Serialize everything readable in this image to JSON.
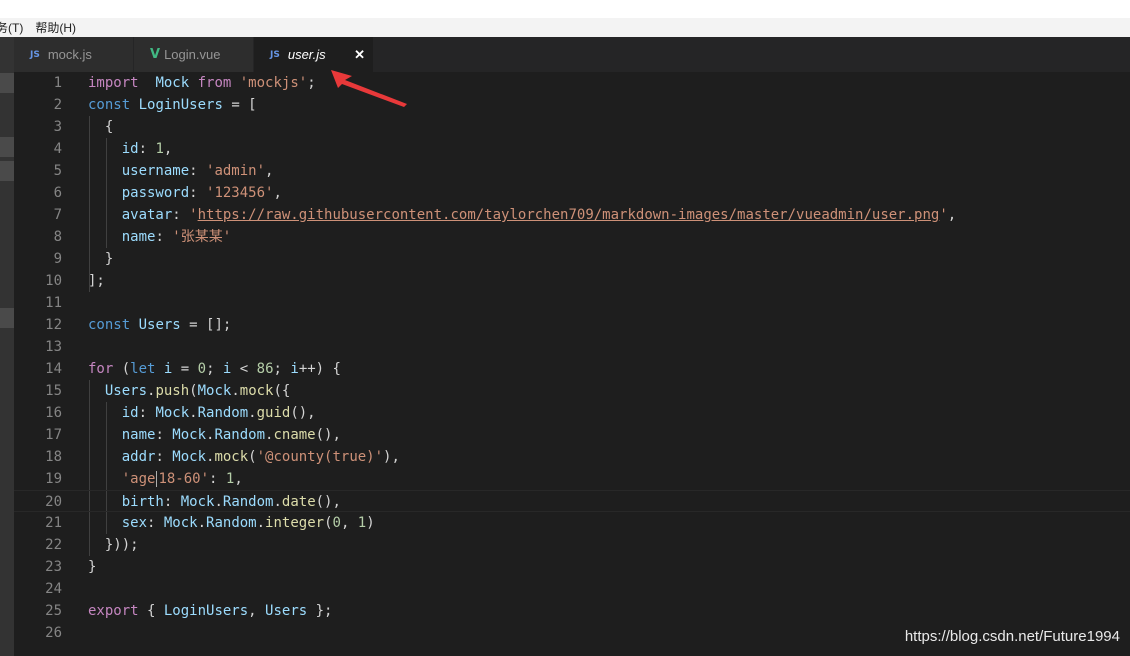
{
  "menu": {
    "items": [
      "务(T)",
      "帮助(H)"
    ]
  },
  "tabs": [
    {
      "icon": "JS",
      "label": "mock.js",
      "active": false
    },
    {
      "icon": "V",
      "label": "Login.vue",
      "active": false
    },
    {
      "icon": "JS",
      "label": "user.js",
      "active": true,
      "close": "✕"
    }
  ],
  "code": {
    "lines": [
      {
        "n": "1",
        "tokens": [
          [
            "ctl",
            "import"
          ],
          [
            "",
            "  "
          ],
          [
            "var",
            "Mock"
          ],
          [
            "",
            " "
          ],
          [
            "ctl",
            "from"
          ],
          [
            "",
            " "
          ],
          [
            "str",
            "'mockjs'"
          ],
          [
            "",
            ";"
          ]
        ]
      },
      {
        "n": "2",
        "tokens": [
          [
            "kw",
            "const"
          ],
          [
            "",
            " "
          ],
          [
            "var",
            "LoginUsers"
          ],
          [
            "",
            " = ["
          ]
        ]
      },
      {
        "n": "3",
        "tokens": [
          [
            "",
            "  {"
          ]
        ]
      },
      {
        "n": "4",
        "tokens": [
          [
            "",
            "    "
          ],
          [
            "var",
            "id"
          ],
          [
            "",
            ": "
          ],
          [
            "num",
            "1"
          ],
          [
            "",
            ","
          ]
        ]
      },
      {
        "n": "5",
        "tokens": [
          [
            "",
            "    "
          ],
          [
            "var",
            "username"
          ],
          [
            "",
            ": "
          ],
          [
            "str",
            "'admin'"
          ],
          [
            "",
            ","
          ]
        ]
      },
      {
        "n": "6",
        "tokens": [
          [
            "",
            "    "
          ],
          [
            "var",
            "password"
          ],
          [
            "",
            ": "
          ],
          [
            "str",
            "'123456'"
          ],
          [
            "",
            ","
          ]
        ]
      },
      {
        "n": "7",
        "tokens": [
          [
            "",
            "    "
          ],
          [
            "var",
            "avatar"
          ],
          [
            "",
            ": "
          ],
          [
            "str",
            "'"
          ],
          [
            "url",
            "https://raw.githubusercontent.com/taylorchen709/markdown-images/master/vueadmin/user.png"
          ],
          [
            "str",
            "'"
          ],
          [
            "",
            ","
          ]
        ]
      },
      {
        "n": "8",
        "tokens": [
          [
            "",
            "    "
          ],
          [
            "var",
            "name"
          ],
          [
            "",
            ": "
          ],
          [
            "str",
            "'张某某'"
          ]
        ]
      },
      {
        "n": "9",
        "tokens": [
          [
            "",
            "  }"
          ]
        ]
      },
      {
        "n": "10",
        "tokens": [
          [
            "",
            "];"
          ]
        ]
      },
      {
        "n": "11",
        "tokens": []
      },
      {
        "n": "12",
        "tokens": [
          [
            "kw",
            "const"
          ],
          [
            "",
            " "
          ],
          [
            "var",
            "Users"
          ],
          [
            "",
            " = [];"
          ]
        ]
      },
      {
        "n": "13",
        "tokens": []
      },
      {
        "n": "14",
        "tokens": [
          [
            "ctl",
            "for"
          ],
          [
            "",
            " ("
          ],
          [
            "kw",
            "let"
          ],
          [
            "",
            " "
          ],
          [
            "var",
            "i"
          ],
          [
            "",
            " = "
          ],
          [
            "num",
            "0"
          ],
          [
            "",
            "; "
          ],
          [
            "var",
            "i"
          ],
          [
            "",
            " < "
          ],
          [
            "num",
            "86"
          ],
          [
            "",
            "; "
          ],
          [
            "var",
            "i"
          ],
          [
            "",
            "++) {"
          ]
        ]
      },
      {
        "n": "15",
        "tokens": [
          [
            "",
            "  "
          ],
          [
            "var",
            "Users"
          ],
          [
            "",
            "."
          ],
          [
            "fn",
            "push"
          ],
          [
            "",
            "("
          ],
          [
            "var",
            "Mock"
          ],
          [
            "",
            "."
          ],
          [
            "fn",
            "mock"
          ],
          [
            "",
            "({"
          ]
        ]
      },
      {
        "n": "16",
        "tokens": [
          [
            "",
            "    "
          ],
          [
            "var",
            "id"
          ],
          [
            "",
            ": "
          ],
          [
            "var",
            "Mock"
          ],
          [
            "",
            "."
          ],
          [
            "var",
            "Random"
          ],
          [
            "",
            "."
          ],
          [
            "fn",
            "guid"
          ],
          [
            "",
            "(),"
          ]
        ]
      },
      {
        "n": "17",
        "tokens": [
          [
            "",
            "    "
          ],
          [
            "var",
            "name"
          ],
          [
            "",
            ": "
          ],
          [
            "var",
            "Mock"
          ],
          [
            "",
            "."
          ],
          [
            "var",
            "Random"
          ],
          [
            "",
            "."
          ],
          [
            "fn",
            "cname"
          ],
          [
            "",
            "(),"
          ]
        ]
      },
      {
        "n": "18",
        "tokens": [
          [
            "",
            "    "
          ],
          [
            "var",
            "addr"
          ],
          [
            "",
            ": "
          ],
          [
            "var",
            "Mock"
          ],
          [
            "",
            "."
          ],
          [
            "fn",
            "mock"
          ],
          [
            "",
            "("
          ],
          [
            "str",
            "'@county(true)'"
          ],
          [
            "",
            "),"
          ]
        ]
      },
      {
        "n": "19",
        "tokens": [
          [
            "",
            "    "
          ],
          [
            "str",
            "'age"
          ],
          [
            "caret",
            ""
          ],
          [
            "str",
            "18-60'"
          ],
          [
            "",
            ": "
          ],
          [
            "num",
            "1"
          ],
          [
            "",
            ","
          ]
        ]
      },
      {
        "n": "20",
        "tokens": [
          [
            "",
            "    "
          ],
          [
            "var",
            "birth"
          ],
          [
            "",
            ": "
          ],
          [
            "var",
            "Mock"
          ],
          [
            "",
            "."
          ],
          [
            "var",
            "Random"
          ],
          [
            "",
            "."
          ],
          [
            "fn",
            "date"
          ],
          [
            "",
            "(),"
          ]
        ]
      },
      {
        "n": "21",
        "tokens": [
          [
            "",
            "    "
          ],
          [
            "var",
            "sex"
          ],
          [
            "",
            ": "
          ],
          [
            "var",
            "Mock"
          ],
          [
            "",
            "."
          ],
          [
            "var",
            "Random"
          ],
          [
            "",
            "."
          ],
          [
            "fn",
            "integer"
          ],
          [
            "",
            "("
          ],
          [
            "num",
            "0"
          ],
          [
            "",
            ", "
          ],
          [
            "num",
            "1"
          ],
          [
            "",
            ")"
          ]
        ]
      },
      {
        "n": "22",
        "tokens": [
          [
            "",
            "  }));"
          ]
        ]
      },
      {
        "n": "23",
        "tokens": [
          [
            "",
            "}"
          ]
        ]
      },
      {
        "n": "24",
        "tokens": []
      },
      {
        "n": "25",
        "tokens": [
          [
            "ctl",
            "export"
          ],
          [
            "",
            " { "
          ],
          [
            "var",
            "LoginUsers"
          ],
          [
            "",
            ", "
          ],
          [
            "var",
            "Users"
          ],
          [
            "",
            " };"
          ]
        ]
      },
      {
        "n": "26",
        "tokens": []
      }
    ],
    "current_line": "20"
  },
  "watermark": "https://blog.csdn.net/Future1994",
  "colors": {
    "arrow": "#e8393a",
    "keyword": "#569cd6",
    "control": "#c586c0",
    "string": "#ce9178",
    "number": "#b5cea8"
  }
}
